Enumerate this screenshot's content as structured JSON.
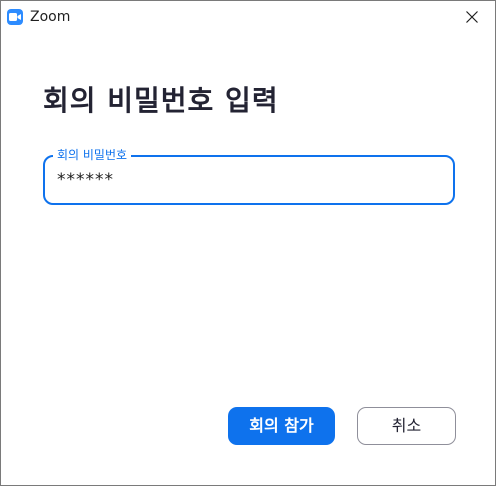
{
  "window": {
    "title": "Zoom",
    "app_icon": "zoom-camera-icon",
    "close_icon": "close-icon"
  },
  "dialog": {
    "heading": "회의 비밀번호 입력",
    "password_field": {
      "label": "회의 비밀번호",
      "value": "******"
    },
    "join_button": "회의 참가",
    "cancel_button": "취소"
  },
  "colors": {
    "accent": "#0e72ed",
    "heading_text": "#232333",
    "app_icon_bg": "#2d8cff"
  }
}
